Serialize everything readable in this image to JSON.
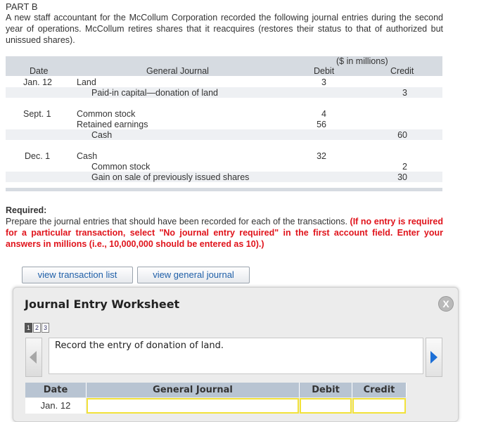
{
  "part_title": "PART B",
  "intro": "A new staff accountant for the McCollum Corporation recorded the following journal entries during the second year of operations. McCollum retires shares that it reacquires (restores their status to that of authorized but unissued shares).",
  "journal_table": {
    "units": "($ in millions)",
    "headers": {
      "date": "Date",
      "general_journal": "General Journal",
      "debit": "Debit",
      "credit": "Credit"
    },
    "rows": [
      {
        "date": "Jan. 12",
        "account": "Land",
        "debit": "3",
        "credit": ""
      },
      {
        "date": "",
        "account": "Paid-in capital—donation of land",
        "debit": "",
        "credit": "3"
      },
      {
        "date": "Sept. 1",
        "account": "Common stock",
        "debit": "4",
        "credit": ""
      },
      {
        "date": "",
        "account": "Retained earnings",
        "debit": "56",
        "credit": ""
      },
      {
        "date": "",
        "account": "Cash",
        "debit": "",
        "credit": "60"
      },
      {
        "date": "Dec. 1",
        "account": "Cash",
        "debit": "32",
        "credit": ""
      },
      {
        "date": "",
        "account": "Common stock",
        "debit": "",
        "credit": "2"
      },
      {
        "date": "",
        "account": "Gain on sale of previously issued shares",
        "debit": "",
        "credit": "30"
      }
    ]
  },
  "required": {
    "title": "Required:",
    "text": "Prepare the journal entries that should have been recorded for each of the transactions. ",
    "instructions": "(If no entry is required for a particular transaction, select \"No journal entry required\" in the first account field. Enter your answers in millions (i.e., 10,000,000 should be entered as 10).)"
  },
  "buttons": {
    "view_transactions": "view transaction list",
    "view_journal": "view general journal"
  },
  "worksheet": {
    "title": "Journal Entry Worksheet",
    "close_glyph": "X",
    "steps": [
      "1",
      "2",
      "3"
    ],
    "prompt": "Record the entry of donation of land.",
    "headers": {
      "date": "Date",
      "general_journal": "General Journal",
      "debit": "Debit",
      "credit": "Credit"
    },
    "first_row_date": "Jan. 12"
  }
}
